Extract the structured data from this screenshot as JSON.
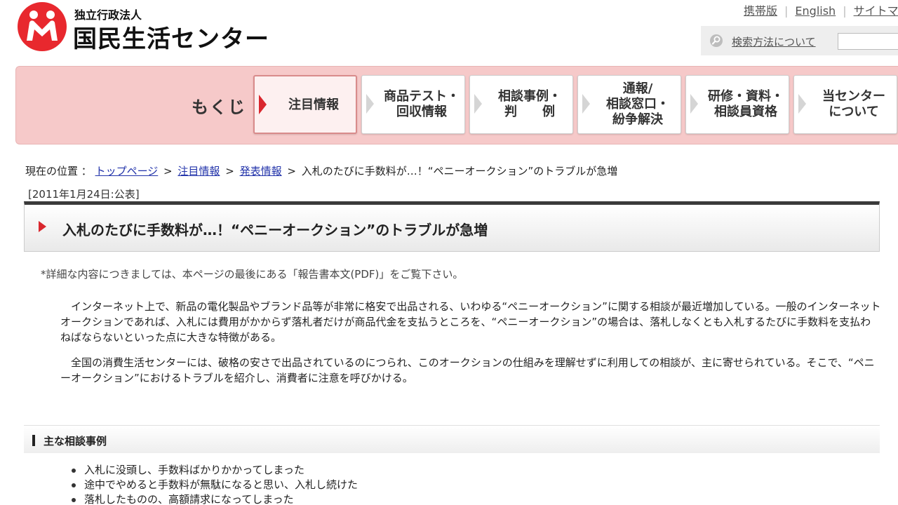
{
  "header": {
    "org_type": "独立行政法人",
    "org_name": "国民生活センター",
    "util_links": [
      "携帯版",
      "English",
      "サイトマ"
    ],
    "search_help": "検索方法について",
    "search_value": ""
  },
  "nav": {
    "title": "もくじ",
    "items": [
      {
        "label": "注目情報"
      },
      {
        "label": "商品テスト・\n回収情報"
      },
      {
        "label": "相談事例・\n判　　例"
      },
      {
        "label": "通報/\n相談窓口・\n紛争解決"
      },
      {
        "label": "研修・資料・\n相談員資格"
      },
      {
        "label": "当センター\nについて"
      }
    ]
  },
  "breadcrumb": {
    "prefix": "現在の位置 ：",
    "links": [
      "トップページ",
      "注目情報",
      "発表情報"
    ],
    "current": "入札のたびに手数料が…！“ペニーオークション”のトラブルが急増",
    "sep": ">"
  },
  "article": {
    "date": "[2011年1月24日:公表]",
    "title": "入札のたびに手数料が…！“ペニーオークション”のトラブルが急増",
    "note": "*詳細な内容につきましては、本ページの最後にある「報告書本文(PDF)」をご覧下さい。",
    "para1": "インターネット上で、新品の電化製品やブランド品等が非常に格安で出品される、いわゆる“ペニーオークション”に関する相談が最近増加している。一般のインターネットオークションであれば、入札には費用がかからず落札者だけが商品代金を支払うところを、“ペニーオークション”の場合は、落札しなくとも入札するたびに手数料を支払わねばならないといった点に大きな特徴がある。",
    "para2": "全国の消費生活センターには、破格の安さで出品されているのにつられ、このオークションの仕組みを理解せずに利用しての相談が、主に寄せられている。そこで、“ペニーオークション”におけるトラブルを紹介し、消費者に注意を呼びかける。"
  },
  "section": {
    "heading": "主な相談事例",
    "items": [
      "入札に没頭し、手数料ばかりかかってしまった",
      "途中でやめると手数料が無駄になると思い、入札し続けた",
      "落札したものの、高額請求になってしまった"
    ]
  },
  "colors": {
    "accent": "#d9272e",
    "nav_bg": "#f6c9c9",
    "link": "#2233aa"
  }
}
